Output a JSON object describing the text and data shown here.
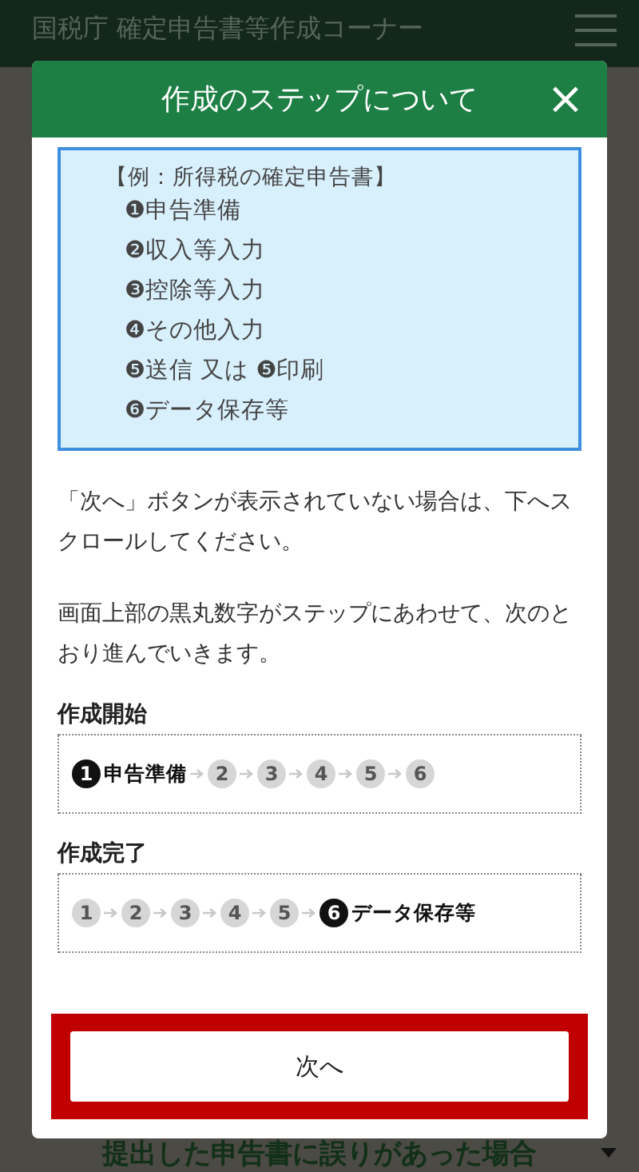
{
  "page": {
    "title": "国税庁 確定申告書等作成コーナー",
    "section_heading": "提出した申告書に誤りがあった場合"
  },
  "dialog": {
    "title": "作成のステップについて",
    "close": "×",
    "example": {
      "heading": "【例：所得税の確定申告書】",
      "steps": [
        "❶申告準備",
        "❷収入等入力",
        "❸控除等入力",
        "❹その他入力",
        "❺送信 又は ❺印刷",
        "❻データ保存等"
      ]
    },
    "paragraphs": [
      "「次へ」ボタンが表示されていない場合は、下へスクロールしてください。",
      "画面上部の黒丸数字がステップにあわせて、次のとおり進んでいきます。"
    ],
    "flows": [
      {
        "title": "作成開始",
        "steps": [
          {
            "number": "1",
            "label": "申告準備",
            "active": true
          },
          {
            "number": "2",
            "active": false
          },
          {
            "number": "3",
            "active": false
          },
          {
            "number": "4",
            "active": false
          },
          {
            "number": "5",
            "active": false
          },
          {
            "number": "6",
            "active": false
          }
        ]
      },
      {
        "title": "作成完了",
        "steps": [
          {
            "number": "1",
            "active": false
          },
          {
            "number": "2",
            "active": false
          },
          {
            "number": "3",
            "active": false
          },
          {
            "number": "4",
            "active": false
          },
          {
            "number": "5",
            "active": false
          },
          {
            "number": "6",
            "label": "データ保存等",
            "active": true
          }
        ]
      }
    ],
    "next_button": {
      "label": "次へ",
      "highlighted": true
    }
  }
}
